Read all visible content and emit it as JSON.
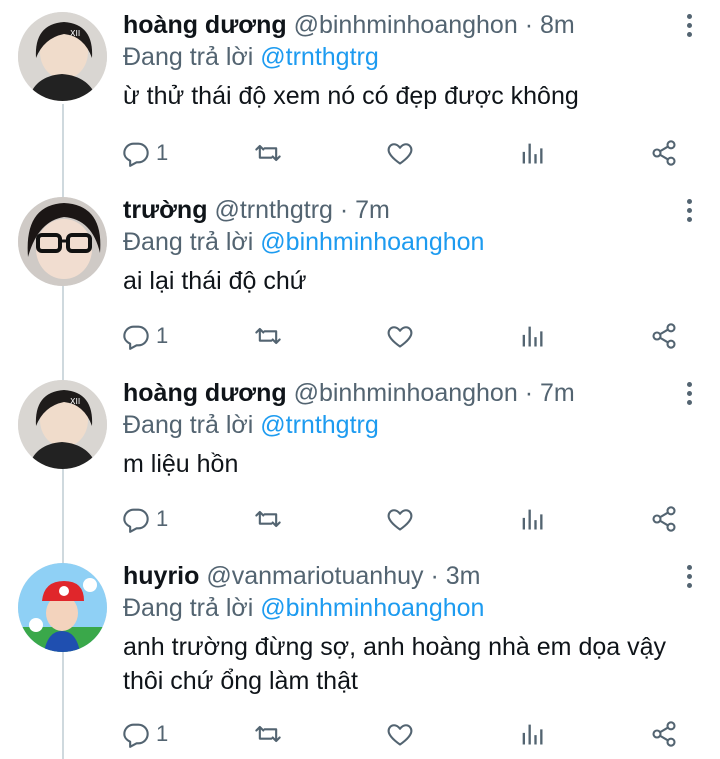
{
  "tweets": [
    {
      "name": "hoàng dương",
      "handle": "@binhminhoanghon",
      "dot": "·",
      "time": "8m",
      "reply_prefix": "Đang trả lời ",
      "reply_to": "@trnthgtrg",
      "text": "ừ thử thái độ xem nó có đẹp được không",
      "reply_count": "1"
    },
    {
      "name": "trường",
      "handle": "@trnthgtrg",
      "dot": "·",
      "time": "7m",
      "reply_prefix": "Đang trả lời ",
      "reply_to": "@binhminhoanghon",
      "text": "ai lại thái độ chứ",
      "reply_count": "1"
    },
    {
      "name": "hoàng dương",
      "handle": "@binhminhoanghon",
      "dot": "·",
      "time": "7m",
      "reply_prefix": "Đang trả lời ",
      "reply_to": "@trnthgtrg",
      "text": "m liệu hồn",
      "reply_count": "1"
    },
    {
      "name": "huyrio",
      "handle": "@vanmariotuanhuy",
      "dot": "·",
      "time": "3m",
      "reply_prefix": "Đang trả lời ",
      "reply_to": "@binhminhoanghon",
      "text": "anh trường đừng sợ, anh hoàng nhà em dọa vậy thôi chứ ổng làm thật",
      "reply_count": "1"
    }
  ],
  "icons": {
    "reply": "reply-icon",
    "retweet": "retweet-icon",
    "like": "heart-icon",
    "analytics": "analytics-icon",
    "share": "share-icon",
    "more": "more-options-icon"
  },
  "colors": {
    "mention": "#1d9bf0",
    "secondary": "#536471",
    "thread_line": "#cfd9de"
  }
}
